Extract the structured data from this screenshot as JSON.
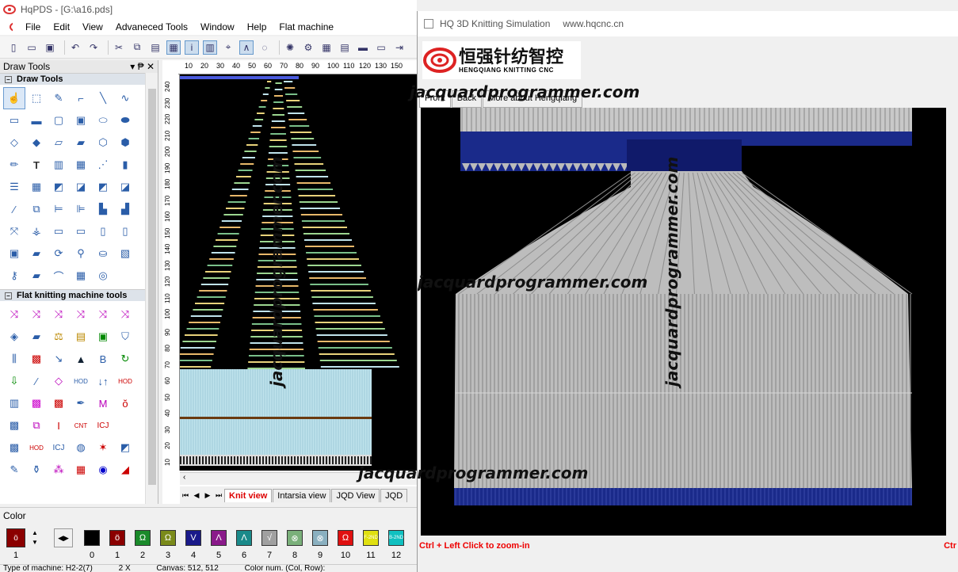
{
  "app": {
    "title": "HqPDS - [G:\\a16.pds]",
    "menu": [
      "File",
      "Edit",
      "View",
      "Advaneced Tools",
      "Window",
      "Help",
      "Flat machine"
    ]
  },
  "panel": {
    "title": "Draw Tools",
    "pin": "▾ ₱ ✕",
    "section1": "Draw Tools",
    "section2": "Flat knitting machine tools"
  },
  "ruler": {
    "top": [
      "10",
      "20",
      "30",
      "40",
      "50",
      "60",
      "70",
      "80",
      "90",
      "100",
      "110",
      "120",
      "130",
      "150"
    ],
    "left": [
      "240",
      "230",
      "220",
      "210",
      "200",
      "190",
      "180",
      "170",
      "160",
      "150",
      "140",
      "130",
      "120",
      "110",
      "100",
      "90",
      "80",
      "70",
      "60",
      "50",
      "40",
      "30",
      "20",
      "10"
    ]
  },
  "tabs": {
    "knit": "Knit view",
    "intarsia": "Intarsia view",
    "jqd": "JQD View",
    "jqd2": "JQD"
  },
  "colorpanel": {
    "header": "Color",
    "selected_num": "1",
    "swatches": [
      {
        "num": "0",
        "color": "#000000",
        "glyph": ""
      },
      {
        "num": "1",
        "color": "#8b0000",
        "glyph": "ö"
      },
      {
        "num": "2",
        "color": "#1a8a2a",
        "glyph": "Ω"
      },
      {
        "num": "3",
        "color": "#7a8a1a",
        "glyph": "Ω"
      },
      {
        "num": "4",
        "color": "#1a1a8a",
        "glyph": "V"
      },
      {
        "num": "5",
        "color": "#8a1a8a",
        "glyph": "Λ"
      },
      {
        "num": "6",
        "color": "#1a8a8a",
        "glyph": "Λ"
      },
      {
        "num": "7",
        "color": "#a0a0a0",
        "glyph": "√"
      },
      {
        "num": "8",
        "color": "#7ab07a",
        "glyph": "⊗"
      },
      {
        "num": "9",
        "color": "#8ab0c0",
        "glyph": "⊗"
      },
      {
        "num": "10",
        "color": "#e01010",
        "glyph": "Ω"
      },
      {
        "num": "11",
        "color": "#e0e010",
        "glyph": "F-2ND"
      },
      {
        "num": "12",
        "color": "#10c0c0",
        "glyph": "B-2ND"
      }
    ]
  },
  "status": {
    "machine": "Type of machine: H2-2(7)",
    "zoom": "2 X",
    "canvas": "Canvas: 512, 512",
    "colornum": "Color num. (Col, Row):"
  },
  "sim": {
    "title": "HQ 3D Knitting Simulation",
    "site": "www.hqcnc.cn",
    "brand_cn": "恒强针纺智控",
    "brand_en": "HENGQIANG KNITTING CNC",
    "tabs": [
      "Front",
      "Back",
      "More about Hengqiang"
    ],
    "hint": "Ctrl + Left Click to zoom-in",
    "hint2": "Ctr"
  },
  "watermarks": {
    "w1": "jacquardprogrammer.com",
    "w2": "jacquardprogrammer.com",
    "w3": "jacquardprogrammer.com",
    "w4": "jacquardprogrammer.com",
    "w5": "jacquardprogrammer.com"
  }
}
